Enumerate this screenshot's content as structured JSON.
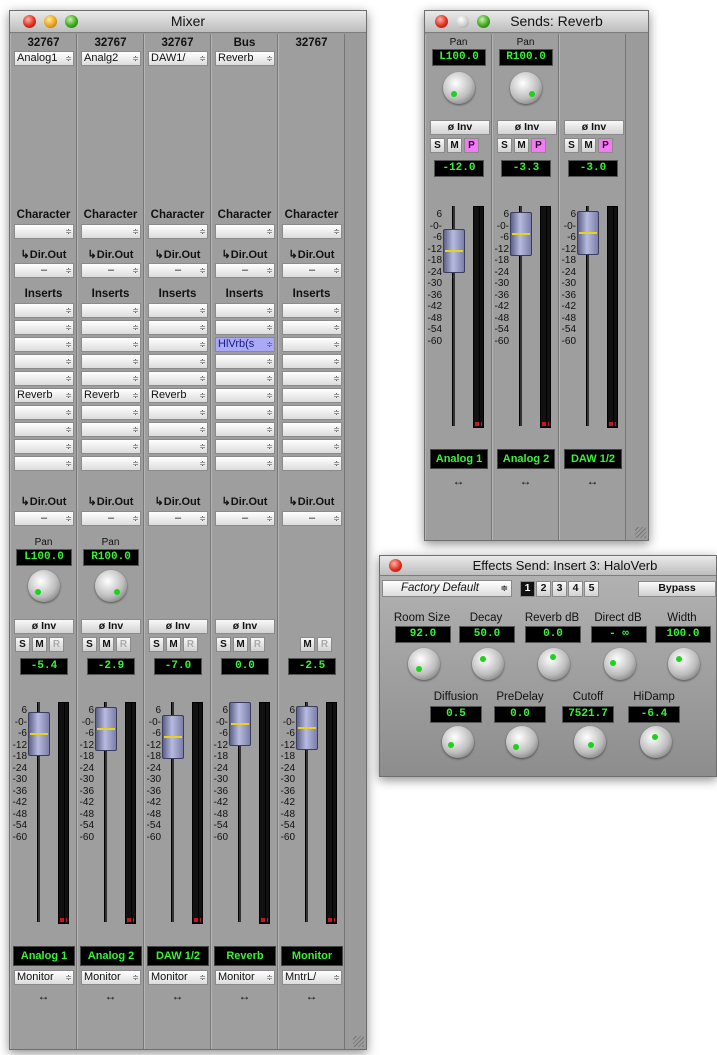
{
  "mixer": {
    "title": "Mixer",
    "strips": [
      {
        "header": "32767",
        "input": "Analog1",
        "character": "Character",
        "dirout": "↳Dir.Out",
        "inserts_label": "Inserts",
        "insert_names": [
          "",
          "",
          "",
          "",
          "",
          "Reverb",
          "",
          "",
          "",
          ""
        ],
        "pan_label": "Pan",
        "pan": "L100.0",
        "inv": "ø Inv",
        "solo": "S",
        "mute": "M",
        "rec": "R",
        "level": "-5.4",
        "name": "Analog 1",
        "output": "Monitor",
        "arrow": "↔",
        "fader_db": -5.4
      },
      {
        "header": "32767",
        "input": "Analg2",
        "character": "Character",
        "dirout": "↳Dir.Out",
        "inserts_label": "Inserts",
        "insert_names": [
          "",
          "",
          "",
          "",
          "",
          "Reverb",
          "",
          "",
          "",
          ""
        ],
        "pan_label": "Pan",
        "pan": "R100.0",
        "inv": "ø Inv",
        "solo": "S",
        "mute": "M",
        "rec": "R",
        "level": "-2.9",
        "name": "Analog 2",
        "output": "Monitor",
        "arrow": "↔",
        "fader_db": -2.9
      },
      {
        "header": "32767",
        "input": "DAW1/",
        "character": "Character",
        "dirout": "↳Dir.Out",
        "inserts_label": "Inserts",
        "insert_names": [
          "",
          "",
          "",
          "",
          "",
          "Reverb",
          "",
          "",
          "",
          ""
        ],
        "pan_label": "",
        "pan": "",
        "inv": "ø Inv",
        "solo": "S",
        "mute": "M",
        "rec": "R",
        "level": "-7.0",
        "name": "DAW 1/2",
        "output": "Monitor",
        "arrow": "↔",
        "fader_db": -7.0
      },
      {
        "header": "Bus",
        "input": "Reverb",
        "character": "Character",
        "dirout": "↳Dir.Out",
        "inserts_label": "Inserts",
        "insert_names": [
          "",
          "",
          "HlVrb(s",
          "",
          "",
          "",
          "",
          "",
          "",
          ""
        ],
        "pan_label": "",
        "pan": "",
        "inv": "ø Inv",
        "solo": "S",
        "mute": "M",
        "rec": "R",
        "level": "0.0",
        "name": "Reverb",
        "output": "Monitor",
        "arrow": "↔",
        "fader_db": 0.0
      },
      {
        "header": "32767",
        "input": "",
        "character": "Character",
        "dirout": "↳Dir.Out",
        "inserts_label": "Inserts",
        "insert_names": [
          "",
          "",
          "",
          "",
          "",
          "",
          "",
          "",
          "",
          ""
        ],
        "pan_label": "",
        "pan": "",
        "inv": "",
        "solo": "",
        "mute": "M",
        "rec": "R",
        "level": "-2.5",
        "name": "Monitor",
        "output": "MntrL/",
        "arrow": "↔",
        "fader_db": -2.5
      }
    ],
    "dirout_value": "–",
    "scale_labels": [
      "6",
      "-0-",
      "-6",
      "-12",
      "-18",
      "-24",
      "-30",
      "-36",
      "-42",
      "-48",
      "-54",
      "-60"
    ]
  },
  "sends": {
    "title": "Sends: Reverb",
    "strips": [
      {
        "pan_label": "Pan",
        "pan": "L100.0",
        "inv": "ø Inv",
        "s": "S",
        "m": "M",
        "p": "P",
        "level": "-12.0",
        "name": "Analog 1",
        "arrow": "↔",
        "fader_db": -12.0
      },
      {
        "pan_label": "Pan",
        "pan": "R100.0",
        "inv": "ø Inv",
        "s": "S",
        "m": "M",
        "p": "P",
        "level": "-3.3",
        "name": "Analog 2",
        "arrow": "↔",
        "fader_db": -3.3
      },
      {
        "pan_label": "",
        "pan": "",
        "inv": "ø Inv",
        "s": "S",
        "m": "M",
        "p": "P",
        "level": "-3.0",
        "name": "DAW 1/2",
        "arrow": "↔",
        "fader_db": -3.0
      }
    ]
  },
  "effects": {
    "title": "Effects Send: Insert 3: HaloVerb",
    "preset": "Factory Default",
    "slots": [
      "1",
      "2",
      "3",
      "4",
      "5"
    ],
    "active_slot": "1",
    "bypass": "Bypass",
    "row1": [
      {
        "label": "Room Size",
        "value": "92.0"
      },
      {
        "label": "Decay",
        "value": "50.0"
      },
      {
        "label": "Reverb dB",
        "value": "0.0"
      },
      {
        "label": "Direct dB",
        "value": "- ∞"
      },
      {
        "label": "Width",
        "value": "100.0"
      }
    ],
    "row2": [
      {
        "label": "Diffusion",
        "value": "0.5"
      },
      {
        "label": "PreDelay",
        "value": "0.0"
      },
      {
        "label": "Cutoff",
        "value": "7521.7"
      },
      {
        "label": "HiDamp",
        "value": "-6.4"
      }
    ]
  }
}
